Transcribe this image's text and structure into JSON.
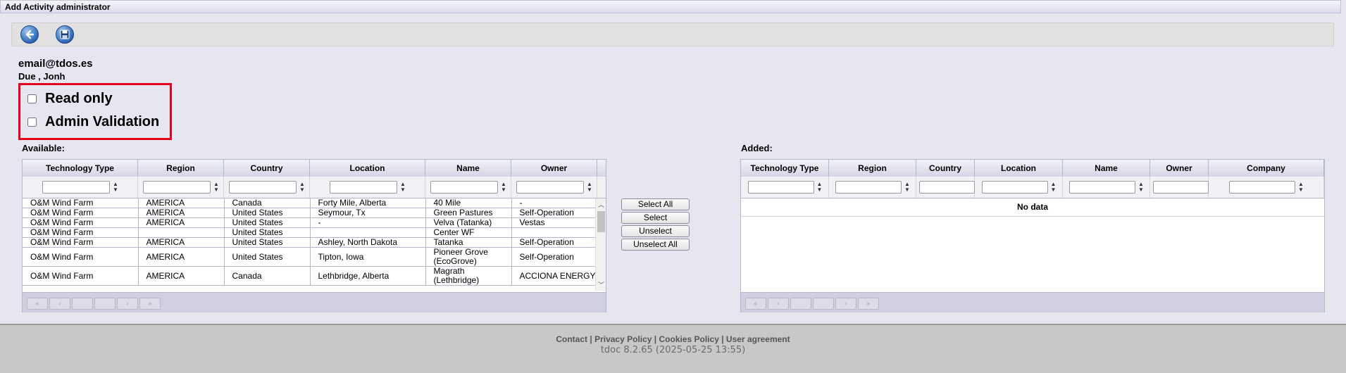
{
  "window": {
    "title": "Add Activity administrator"
  },
  "toolbar": {
    "back_icon": "back-arrow-icon",
    "save_icon": "floppy-disk-icon"
  },
  "user": {
    "email": "email@tdos.es",
    "name": "Due , Jonh"
  },
  "options": [
    {
      "label": "Read only",
      "checked": false
    },
    {
      "label": "Admin Validation",
      "checked": false
    }
  ],
  "available": {
    "label": "Available:",
    "columns": [
      "Technology Type",
      "Region",
      "Country",
      "Location",
      "Name",
      "Owner"
    ],
    "rows": [
      [
        "O&M Wind Farm",
        "AMERICA",
        "Canada",
        "Forty Mile, Alberta",
        "40 Mile",
        "-"
      ],
      [
        "O&M Wind Farm",
        "AMERICA",
        "United States",
        "Seymour, Tx",
        "Green Pastures",
        "Self-Operation"
      ],
      [
        "O&M Wind Farm",
        "AMERICA",
        "United States",
        "-",
        "Velva (Tatanka)",
        "Vestas"
      ],
      [
        "O&M Wind Farm",
        "",
        "United States",
        "",
        "Center WF",
        ""
      ],
      [
        "O&M Wind Farm",
        "AMERICA",
        "United States",
        "Ashley, North Dakota",
        "Tatanka",
        "Self-Operation"
      ],
      [
        "O&M Wind Farm",
        "AMERICA",
        "United States",
        "Tipton, Iowa",
        "Pioneer Grove (EcoGrove)",
        "Self-Operation"
      ],
      [
        "O&M Wind Farm",
        "AMERICA",
        "Canada",
        "Lethbridge, Alberta",
        "Magrath (Lethbridge)",
        "ACCIONA ENERGY"
      ]
    ]
  },
  "actions": {
    "select_all": "Select All",
    "select": "Select",
    "unselect": "Unselect",
    "unselect_all": "Unselect All"
  },
  "added": {
    "label": "Added:",
    "columns": [
      "Technology Type",
      "Region",
      "Country",
      "Location",
      "Name",
      "Owner",
      "Company"
    ],
    "empty_text": "No data"
  },
  "pager": {
    "first": "«",
    "prev": "‹",
    "next": "›",
    "last": "»"
  },
  "footer": {
    "links": [
      "Contact",
      "Privacy Policy",
      "Cookies Policy",
      "User agreement"
    ],
    "separator": "|",
    "version": "tdoc 8.2.65 (2025-05-25 13:55)"
  }
}
